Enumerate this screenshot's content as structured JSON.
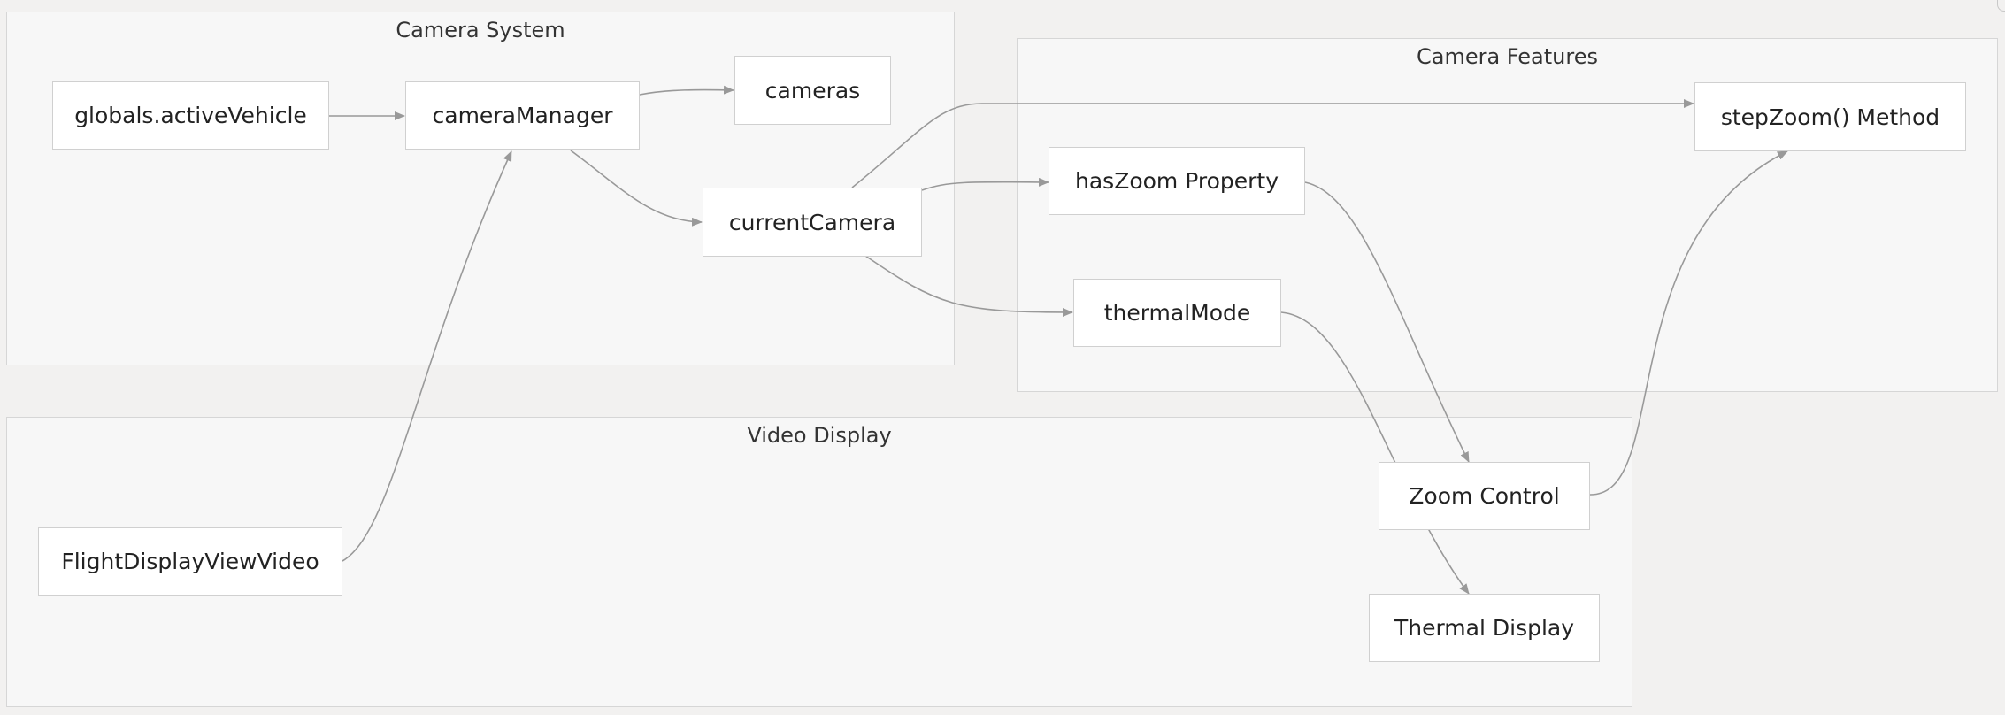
{
  "clusters": {
    "camera_system": "Camera System",
    "camera_features": "Camera Features",
    "video_display": "Video Display"
  },
  "nodes": {
    "active_vehicle": "globals.activeVehicle",
    "camera_manager": "cameraManager",
    "cameras": "cameras",
    "current_camera": "currentCamera",
    "step_zoom": "stepZoom() Method",
    "has_zoom": "hasZoom Property",
    "thermal_mode": "thermalMode",
    "flight_display_video": "FlightDisplayViewVideo",
    "zoom_control": "Zoom Control",
    "thermal_display": "Thermal Display"
  },
  "edges": [
    {
      "from": "globals.activeVehicle",
      "to": "cameraManager"
    },
    {
      "from": "cameraManager",
      "to": "cameras"
    },
    {
      "from": "cameraManager",
      "to": "currentCamera"
    },
    {
      "from": "currentCamera",
      "to": "stepZoom() Method"
    },
    {
      "from": "currentCamera",
      "to": "hasZoom Property"
    },
    {
      "from": "currentCamera",
      "to": "thermalMode"
    },
    {
      "from": "FlightDisplayViewVideo",
      "to": "cameraManager"
    },
    {
      "from": "hasZoom Property",
      "to": "Zoom Control"
    },
    {
      "from": "thermalMode",
      "to": "Thermal Display"
    },
    {
      "from": "Zoom Control",
      "to": "stepZoom() Method"
    }
  ],
  "colors": {
    "background": "#f2f1f0",
    "cluster_fill": "#f7f7f7",
    "node_fill": "#ffffff",
    "edge": "#999999"
  }
}
